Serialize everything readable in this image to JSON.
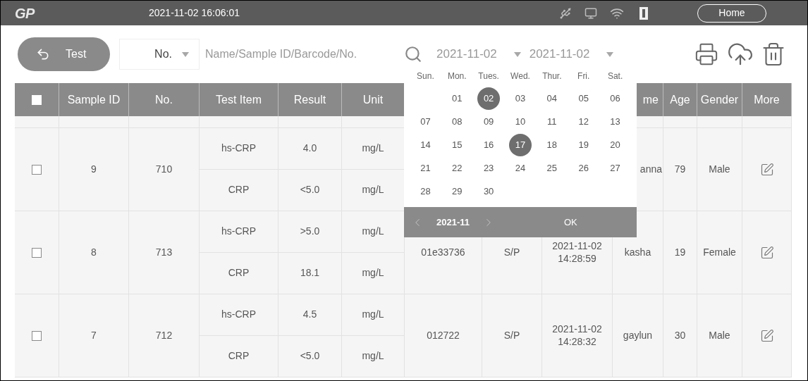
{
  "top_bar": {
    "logo": "GP",
    "datetime": "2021-11-02 16:06:01",
    "home_button": "Home"
  },
  "toolbar": {
    "back_button": "Test",
    "search_type": "No.",
    "search": {
      "placeholder": "Name/Sample ID/Barcode/No."
    },
    "date_from": "2021-11-02",
    "date_to": "2021-11-02"
  },
  "table": {
    "all_checked": false,
    "columns": [
      "Sample ID",
      "No.",
      "Test Item",
      "Result",
      "Unit",
      "me",
      "Age",
      "Gender",
      "More"
    ],
    "rows": [
      {
        "checked": false,
        "sample_id": "9",
        "no": "710",
        "tests": [
          {
            "item": "hs-CRP",
            "result": "4.0",
            "unit": "mg/L"
          },
          {
            "item": "CRP",
            "result": "<5.0",
            "unit": "mg/L"
          }
        ],
        "name": "anna",
        "age": "79",
        "gender": "Male"
      },
      {
        "checked": false,
        "sample_id": "8",
        "no": "713",
        "tests": [
          {
            "item": "hs-CRP",
            "result": ">5.0",
            "unit": "mg/L"
          },
          {
            "item": "CRP",
            "result": "18.1",
            "unit": "mg/L"
          }
        ],
        "barcode": "01e33736",
        "type": "S/P",
        "date": "2021-11-02",
        "time": "14:28:59",
        "name": "kasha",
        "age": "19",
        "gender": "Female"
      },
      {
        "checked": false,
        "sample_id": "7",
        "no": "712",
        "tests": [
          {
            "item": "hs-CRP",
            "result": "4.5",
            "unit": "mg/L"
          },
          {
            "item": "CRP",
            "result": "<5.0",
            "unit": "mg/L"
          }
        ],
        "barcode": "012722",
        "type": "S/P",
        "date": "2021-11-02",
        "time": "14:28:32",
        "name": "gaylun",
        "age": "30",
        "gender": "Male"
      }
    ]
  },
  "calendar": {
    "weekdays": [
      "Sun.",
      "Mon.",
      "Tues.",
      "Wed.",
      "Thur.",
      "Fri.",
      "Sat."
    ],
    "weeks": [
      {
        "days": [
          {
            "label": "01",
            "selected": false
          },
          {
            "label": "02",
            "selected": true
          },
          {
            "label": "03",
            "selected": false
          },
          {
            "label": "04",
            "selected": false
          },
          {
            "label": "05",
            "selected": false
          },
          {
            "label": "06",
            "selected": false
          }
        ]
      },
      {
        "days": [
          {
            "label": "07",
            "selected": false
          },
          {
            "label": "08",
            "selected": false
          },
          {
            "label": "09",
            "selected": false
          },
          {
            "label": "10",
            "selected": false
          },
          {
            "label": "11",
            "selected": false
          },
          {
            "label": "12",
            "selected": false
          },
          {
            "label": "13",
            "selected": false
          }
        ]
      },
      {
        "days": [
          {
            "label": "14",
            "selected": false
          },
          {
            "label": "15",
            "selected": false
          },
          {
            "label": "16",
            "selected": false
          },
          {
            "label": "17",
            "selected": true
          },
          {
            "label": "18",
            "selected": false
          },
          {
            "label": "19",
            "selected": false
          },
          {
            "label": "20",
            "selected": false
          }
        ]
      },
      {
        "days": [
          {
            "label": "21",
            "selected": false
          },
          {
            "label": "22",
            "selected": false
          },
          {
            "label": "23",
            "selected": false
          },
          {
            "label": "24",
            "selected": false
          },
          {
            "label": "25",
            "selected": false
          },
          {
            "label": "26",
            "selected": false
          },
          {
            "label": "27",
            "selected": false
          }
        ]
      },
      {
        "days": [
          {
            "label": "28",
            "selected": false
          },
          {
            "label": "29",
            "selected": false
          },
          {
            "label": "30",
            "selected": false
          }
        ]
      }
    ],
    "month": "2021-11",
    "ok_button": "OK"
  }
}
